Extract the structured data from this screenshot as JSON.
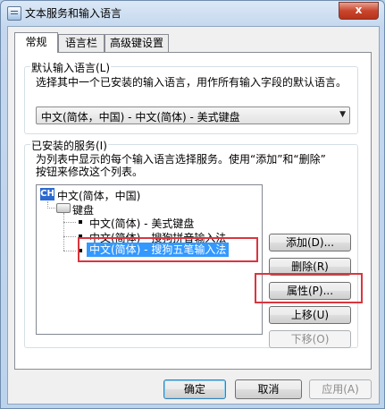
{
  "window": {
    "title": "文本服务和输入语言",
    "close_label": "x"
  },
  "tabs": [
    {
      "label": "常规",
      "active": true
    },
    {
      "label": "语言栏",
      "active": false
    },
    {
      "label": "高级键设置",
      "active": false
    }
  ],
  "default_language": {
    "group_title": "默认输入语言(L)",
    "description": "选择其中一个已安装的输入语言，用作所有输入字段的默认语言。",
    "selected_value": "中文(简体，中国) - 中文(简体) - 美式键盘"
  },
  "installed_services": {
    "group_title": "已安装的服务(I)",
    "description_line1": "为列表中显示的每个输入语言选择服务。使用“添加”和“删除”",
    "description_line2": "按钮来修改这个列表。",
    "tree": {
      "language_badge": "CH",
      "language": "中文(简体，中国)",
      "category": "键盘",
      "items": [
        {
          "label": "中文(简体) - 美式键盘",
          "selected": false
        },
        {
          "label": "中文(简体) - 搜狗拼音输入法",
          "selected": false
        },
        {
          "label": "中文(简体) - 搜狗五笔输入法",
          "selected": true
        }
      ]
    },
    "buttons": {
      "add": "添加(D)...",
      "remove": "删除(R)",
      "properties": "属性(P)...",
      "move_up": "上移(U)",
      "move_down": "下移(O)"
    }
  },
  "footer": {
    "ok": "确定",
    "cancel": "取消",
    "apply": "应用(A)"
  },
  "colors": {
    "highlight": "#3399ff",
    "annotation_red": "#d9363e"
  }
}
